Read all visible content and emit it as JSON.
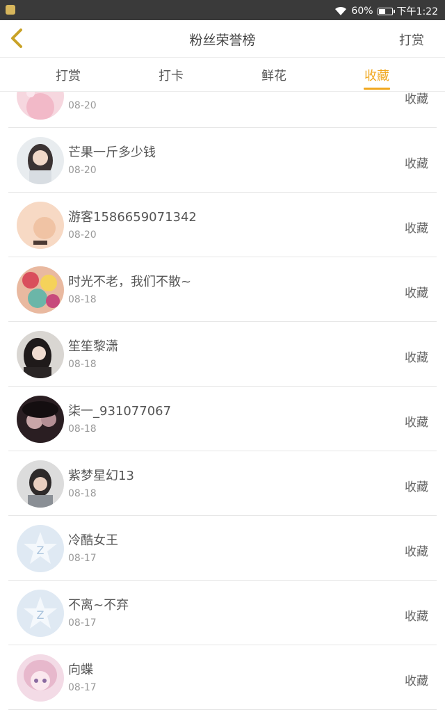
{
  "status": {
    "battery": "60%",
    "battery_level": 0.6,
    "time": "下午1:22"
  },
  "header": {
    "title": "粉丝荣誉榜",
    "action": "打赏"
  },
  "tabs": [
    {
      "label": "打赏",
      "active": false
    },
    {
      "label": "打卡",
      "active": false
    },
    {
      "label": "鲜花",
      "active": false
    },
    {
      "label": "收藏",
      "active": true
    }
  ],
  "items": [
    {
      "name": "",
      "date": "08-20",
      "button": "收藏",
      "avatar": "pink-photo-avatar"
    },
    {
      "name": "芒果一斤多少钱",
      "date": "08-20",
      "button": "收藏",
      "avatar": "girl-photo-avatar"
    },
    {
      "name": "游客1586659071342",
      "date": "08-20",
      "button": "收藏",
      "avatar": "peach-photo-avatar"
    },
    {
      "name": "时光不老，我们不散~",
      "date": "08-18",
      "button": "收藏",
      "avatar": "colorful-anime-avatar"
    },
    {
      "name": "笙笙黎潇",
      "date": "08-18",
      "button": "收藏",
      "avatar": "girl-dark-hair-avatar"
    },
    {
      "name": "柒一_931077067",
      "date": "08-18",
      "button": "收藏",
      "avatar": "dark-photo-avatar"
    },
    {
      "name": "紫梦星幻13",
      "date": "08-18",
      "button": "收藏",
      "avatar": "person-photo-avatar"
    },
    {
      "name": "冷酷女王",
      "date": "08-17",
      "button": "收藏",
      "avatar": "default-qq-star-avatar"
    },
    {
      "name": "不离~不弃",
      "date": "08-17",
      "button": "收藏",
      "avatar": "default-qq-star-avatar"
    },
    {
      "name": "向蝶",
      "date": "08-17",
      "button": "收藏",
      "avatar": "anime-girl-avatar"
    }
  ]
}
